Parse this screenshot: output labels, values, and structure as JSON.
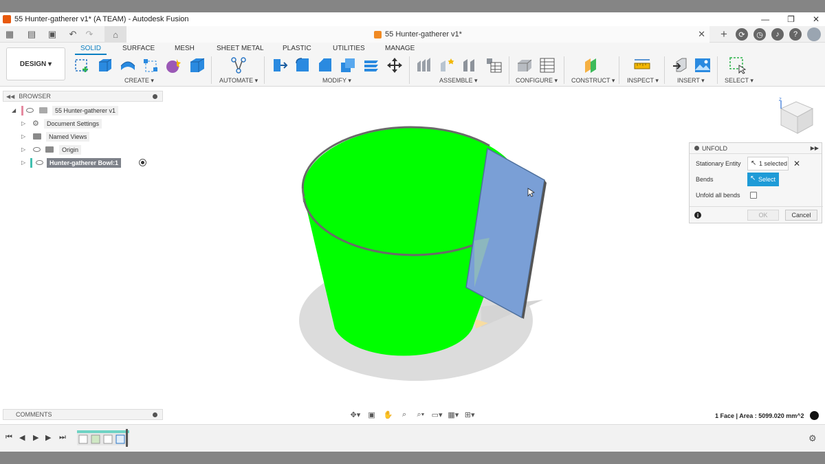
{
  "window": {
    "title": "55 Hunter-gatherer v1* (A TEAM) - Autodesk Fusion",
    "minimize": "—",
    "maximize": "❐",
    "close": "✕"
  },
  "document_tab": {
    "title": "55 Hunter-gatherer v1*",
    "close": "✕"
  },
  "ribbon": {
    "workspace": "DESIGN ▾",
    "tabs": [
      "SOLID",
      "SURFACE",
      "MESH",
      "SHEET METAL",
      "PLASTIC",
      "UTILITIES",
      "MANAGE"
    ],
    "groups": [
      "CREATE ▾",
      "AUTOMATE ▾",
      "MODIFY ▾",
      "ASSEMBLE ▾",
      "CONFIGURE ▾",
      "CONSTRUCT ▾",
      "INSPECT ▾",
      "INSERT ▾",
      "SELECT ▾"
    ]
  },
  "browser": {
    "title": "BROWSER",
    "items": [
      {
        "label": "55 Hunter-gatherer v1"
      },
      {
        "label": "Document Settings"
      },
      {
        "label": "Named Views"
      },
      {
        "label": "Origin"
      },
      {
        "label": "Hunter-gatherer Bowl:1"
      }
    ]
  },
  "comments": {
    "title": "COMMENTS"
  },
  "unfold_dialog": {
    "title": "UNFOLD",
    "stationary_label": "Stationary Entity",
    "stationary_value": "1 selected",
    "bends_label": "Bends",
    "bends_button": "Select",
    "unfold_all_label": "Unfold all bends",
    "ok": "OK",
    "cancel": "Cancel"
  },
  "status": {
    "selection": "1 Face | Area : 5099.020 mm^2"
  },
  "colors": {
    "solid_body": "#00ff00",
    "selected_face": "#7a9fd6",
    "accent": "#1e9bd7"
  }
}
